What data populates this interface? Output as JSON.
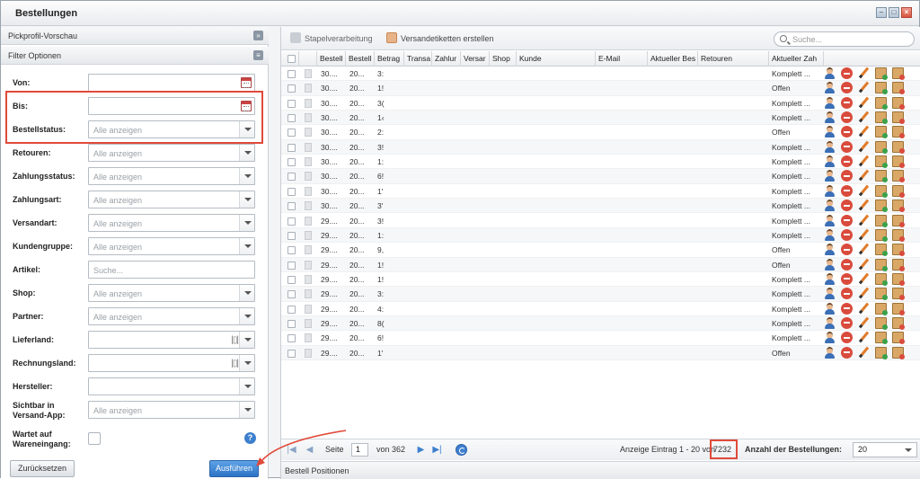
{
  "window": {
    "title": "Bestellungen"
  },
  "left": {
    "pickprofil_title": "Pickprofil-Vorschau",
    "filter_title": "Filter Optionen",
    "filters": [
      {
        "label": "Von:",
        "value": "",
        "placeholder": "",
        "kind": "date"
      },
      {
        "label": "Bis:",
        "value": "",
        "placeholder": "",
        "kind": "date"
      },
      {
        "label": "Bestellstatus:",
        "placeholder": "Alle anzeigen",
        "kind": "select"
      },
      {
        "label": "Retouren:",
        "placeholder": "Alle anzeigen",
        "kind": "select"
      },
      {
        "label": "Zahlungsstatus:",
        "placeholder": "Alle anzeigen",
        "kind": "select"
      },
      {
        "label": "Zahlungsart:",
        "placeholder": "Alle anzeigen",
        "kind": "select"
      },
      {
        "label": "Versandart:",
        "placeholder": "Alle anzeigen",
        "kind": "select"
      },
      {
        "label": "Kundengruppe:",
        "placeholder": "Alle anzeigen",
        "kind": "select"
      },
      {
        "label": "Artikel:",
        "placeholder": "Suche...",
        "kind": "text"
      },
      {
        "label": "Shop:",
        "placeholder": "Alle anzeigen",
        "kind": "select"
      },
      {
        "label": "Partner:",
        "placeholder": "Alle anzeigen",
        "kind": "select"
      },
      {
        "label": "Lieferland:",
        "placeholder": "",
        "kind": "multiselect"
      },
      {
        "label": "Rechnungsland:",
        "placeholder": "",
        "kind": "multiselect"
      },
      {
        "label": "Hersteller:",
        "placeholder": "",
        "kind": "select"
      },
      {
        "label": "Sichtbar in Versand-App:",
        "placeholder": "Alle anzeigen",
        "kind": "select"
      },
      {
        "label": "Wartet auf Wareneingang:",
        "placeholder": "",
        "kind": "checkbox"
      }
    ],
    "reset_label": "Zurücksetzen",
    "execute_label": "Ausführen"
  },
  "toolbar": {
    "batch_label": "Stapelverarbeitung",
    "labels_label": "Versandetiketten erstellen",
    "search_placeholder": "Suche..."
  },
  "grid": {
    "columns": [
      "Bestell",
      "Bestell",
      "Betrag",
      "Transa",
      "Zahlur",
      "Versar",
      "Shop",
      "Kunde",
      "E-Mail",
      "Aktueller Bes",
      "Retouren",
      "Aktueller Zah"
    ],
    "rows": [
      {
        "order": "30....",
        "date": "20...",
        "amount": "3:",
        "status": "Komplett ..."
      },
      {
        "order": "30....",
        "date": "20...",
        "amount": "1!",
        "status": "Offen"
      },
      {
        "order": "30....",
        "date": "20...",
        "amount": "3(",
        "status": "Komplett ..."
      },
      {
        "order": "30....",
        "date": "20...",
        "amount": "1‹",
        "status": "Komplett ..."
      },
      {
        "order": "30....",
        "date": "20...",
        "amount": "2:",
        "status": "Offen"
      },
      {
        "order": "30....",
        "date": "20...",
        "amount": "3!",
        "status": "Komplett ..."
      },
      {
        "order": "30....",
        "date": "20...",
        "amount": "1:",
        "status": "Komplett ..."
      },
      {
        "order": "30....",
        "date": "20...",
        "amount": "6!",
        "status": "Komplett ..."
      },
      {
        "order": "30....",
        "date": "20...",
        "amount": "1'",
        "status": "Komplett ..."
      },
      {
        "order": "30....",
        "date": "20...",
        "amount": "3'",
        "status": "Komplett ..."
      },
      {
        "order": "29....",
        "date": "20...",
        "amount": "3!",
        "status": "Komplett ..."
      },
      {
        "order": "29....",
        "date": "20...",
        "amount": "1:",
        "status": "Komplett ..."
      },
      {
        "order": "29....",
        "date": "20...",
        "amount": "9,",
        "status": "Offen"
      },
      {
        "order": "29....",
        "date": "20...",
        "amount": "1!",
        "status": "Offen"
      },
      {
        "order": "29....",
        "date": "20...",
        "amount": "1!",
        "status": "Komplett ..."
      },
      {
        "order": "29....",
        "date": "20...",
        "amount": "3:",
        "status": "Komplett ..."
      },
      {
        "order": "29....",
        "date": "20...",
        "amount": "4:",
        "status": "Komplett ..."
      },
      {
        "order": "29....",
        "date": "20...",
        "amount": "8(",
        "status": "Komplett ..."
      },
      {
        "order": "29....",
        "date": "20...",
        "amount": "6!",
        "status": "Komplett ..."
      },
      {
        "order": "29....",
        "date": "20...",
        "amount": "1'",
        "status": "Offen"
      }
    ]
  },
  "pager": {
    "page_label": "Seite",
    "page_value": "1",
    "of_label": "von 362",
    "display_label": "Anzeige Eintrag 1 - 20 von",
    "total": "7232",
    "count_label": "Anzahl der Bestellungen:",
    "count_value": "20"
  },
  "bottom": {
    "positions_title": "Bestell Positionen"
  }
}
